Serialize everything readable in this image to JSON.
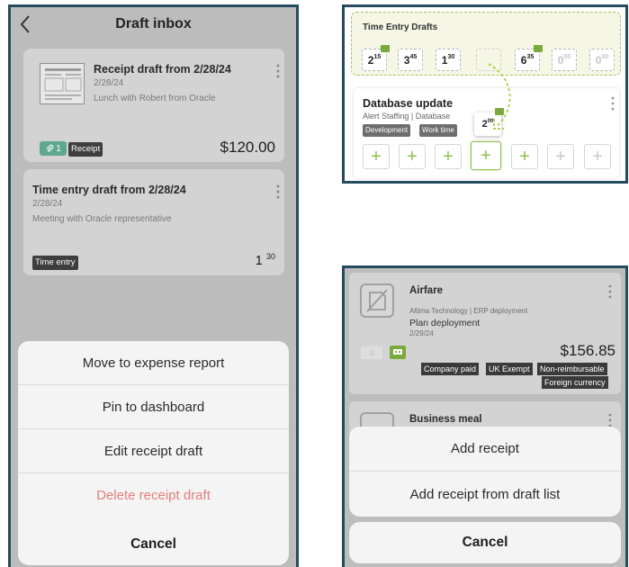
{
  "left": {
    "header_title": "Draft inbox",
    "card1": {
      "title": "Receipt draft from 2/28/24",
      "date": "2/28/24",
      "desc": "Lunch with Robert from Oracle",
      "attach_count": "1",
      "tag": "Receipt",
      "amount": "$120.00"
    },
    "card2": {
      "title": "Time entry draft from 2/28/24",
      "date": "2/28/24",
      "desc": "Meeting with Oracle representative",
      "tag": "Time entry",
      "hours": "1",
      "minutes": "30"
    },
    "sheet": {
      "move": "Move to expense report",
      "pin": "Pin to dashboard",
      "edit": "Edit receipt draft",
      "delete": "Delete receipt draft",
      "cancel": "Cancel"
    }
  },
  "topright": {
    "drafts_title": "Time Entry Drafts",
    "chips": [
      {
        "h": "2",
        "m": "15"
      },
      {
        "h": "3",
        "m": "45"
      },
      {
        "h": "1",
        "m": "30"
      },
      {
        "h": "",
        "m": ""
      },
      {
        "h": "6",
        "m": "35"
      },
      {
        "h": "0",
        "m": "00"
      },
      {
        "h": "0",
        "m": "00"
      }
    ],
    "card": {
      "title": "Database update",
      "sub": "Alert Staffing | Database",
      "tag1": "Development",
      "tag2": "Work time",
      "drag_h": "2",
      "drag_m": "00"
    },
    "plus": "+"
  },
  "bottomright": {
    "card": {
      "title": "Airfare",
      "sub": "Altima Technology | ERP deployment",
      "project": "Plan deployment",
      "date": "2/29/24",
      "attach_count": "0",
      "amount": "$156.85",
      "tags": [
        "Company paid",
        "UK Exempt",
        "Non-reimbursable",
        "Foreign currency"
      ]
    },
    "card2_title": "Business meal",
    "sheet": {
      "add": "Add receipt",
      "add_from": "Add receipt from draft list",
      "cancel": "Cancel"
    }
  },
  "colors": {
    "frame": "#264b5e",
    "accent_green": "#8cbf4d",
    "danger": "#e2807b"
  }
}
